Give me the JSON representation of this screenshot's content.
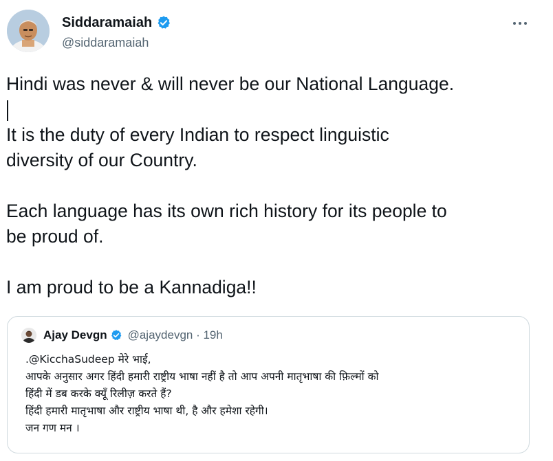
{
  "tweet": {
    "author": {
      "display_name": "Siddaramaiah",
      "handle": "@siddaramaiah",
      "verified_icon": "verified-badge-icon"
    },
    "more_icon": "more-options-icon",
    "lines": {
      "l1": "Hindi was never & will never be our National Language.",
      "l2": "It is the duty of every Indian to respect linguistic",
      "l3": "diversity of our Country.",
      "l4": "Each language has its own rich history for its people to",
      "l5": "be proud of.",
      "l6": "I am proud to be a Kannadiga!!"
    },
    "quoted": {
      "display_name": "Ajay Devgn",
      "meta": "@ajaydevgn · 19h",
      "lines": {
        "l1": ".@KicchaSudeep मेरे भाई,",
        "l2": "आपके अनुसार अगर हिंदी हमारी राष्ट्रीय भाषा नहीं है तो आप अपनी मातृभाषा की फ़िल्मों को",
        "l3": "हिंदी में डब करके क्यूँ रिलीज़ करते हैं?",
        "l4": "हिंदी हमारी मातृभाषा और राष्ट्रीय भाषा थी, है और हमेशा रहेगी।",
        "l5": "जन गण मन ।"
      }
    }
  },
  "colors": {
    "text": "#0f1419",
    "secondary": "#536471",
    "verified": "#1d9bf0",
    "border": "#cfd9de"
  }
}
